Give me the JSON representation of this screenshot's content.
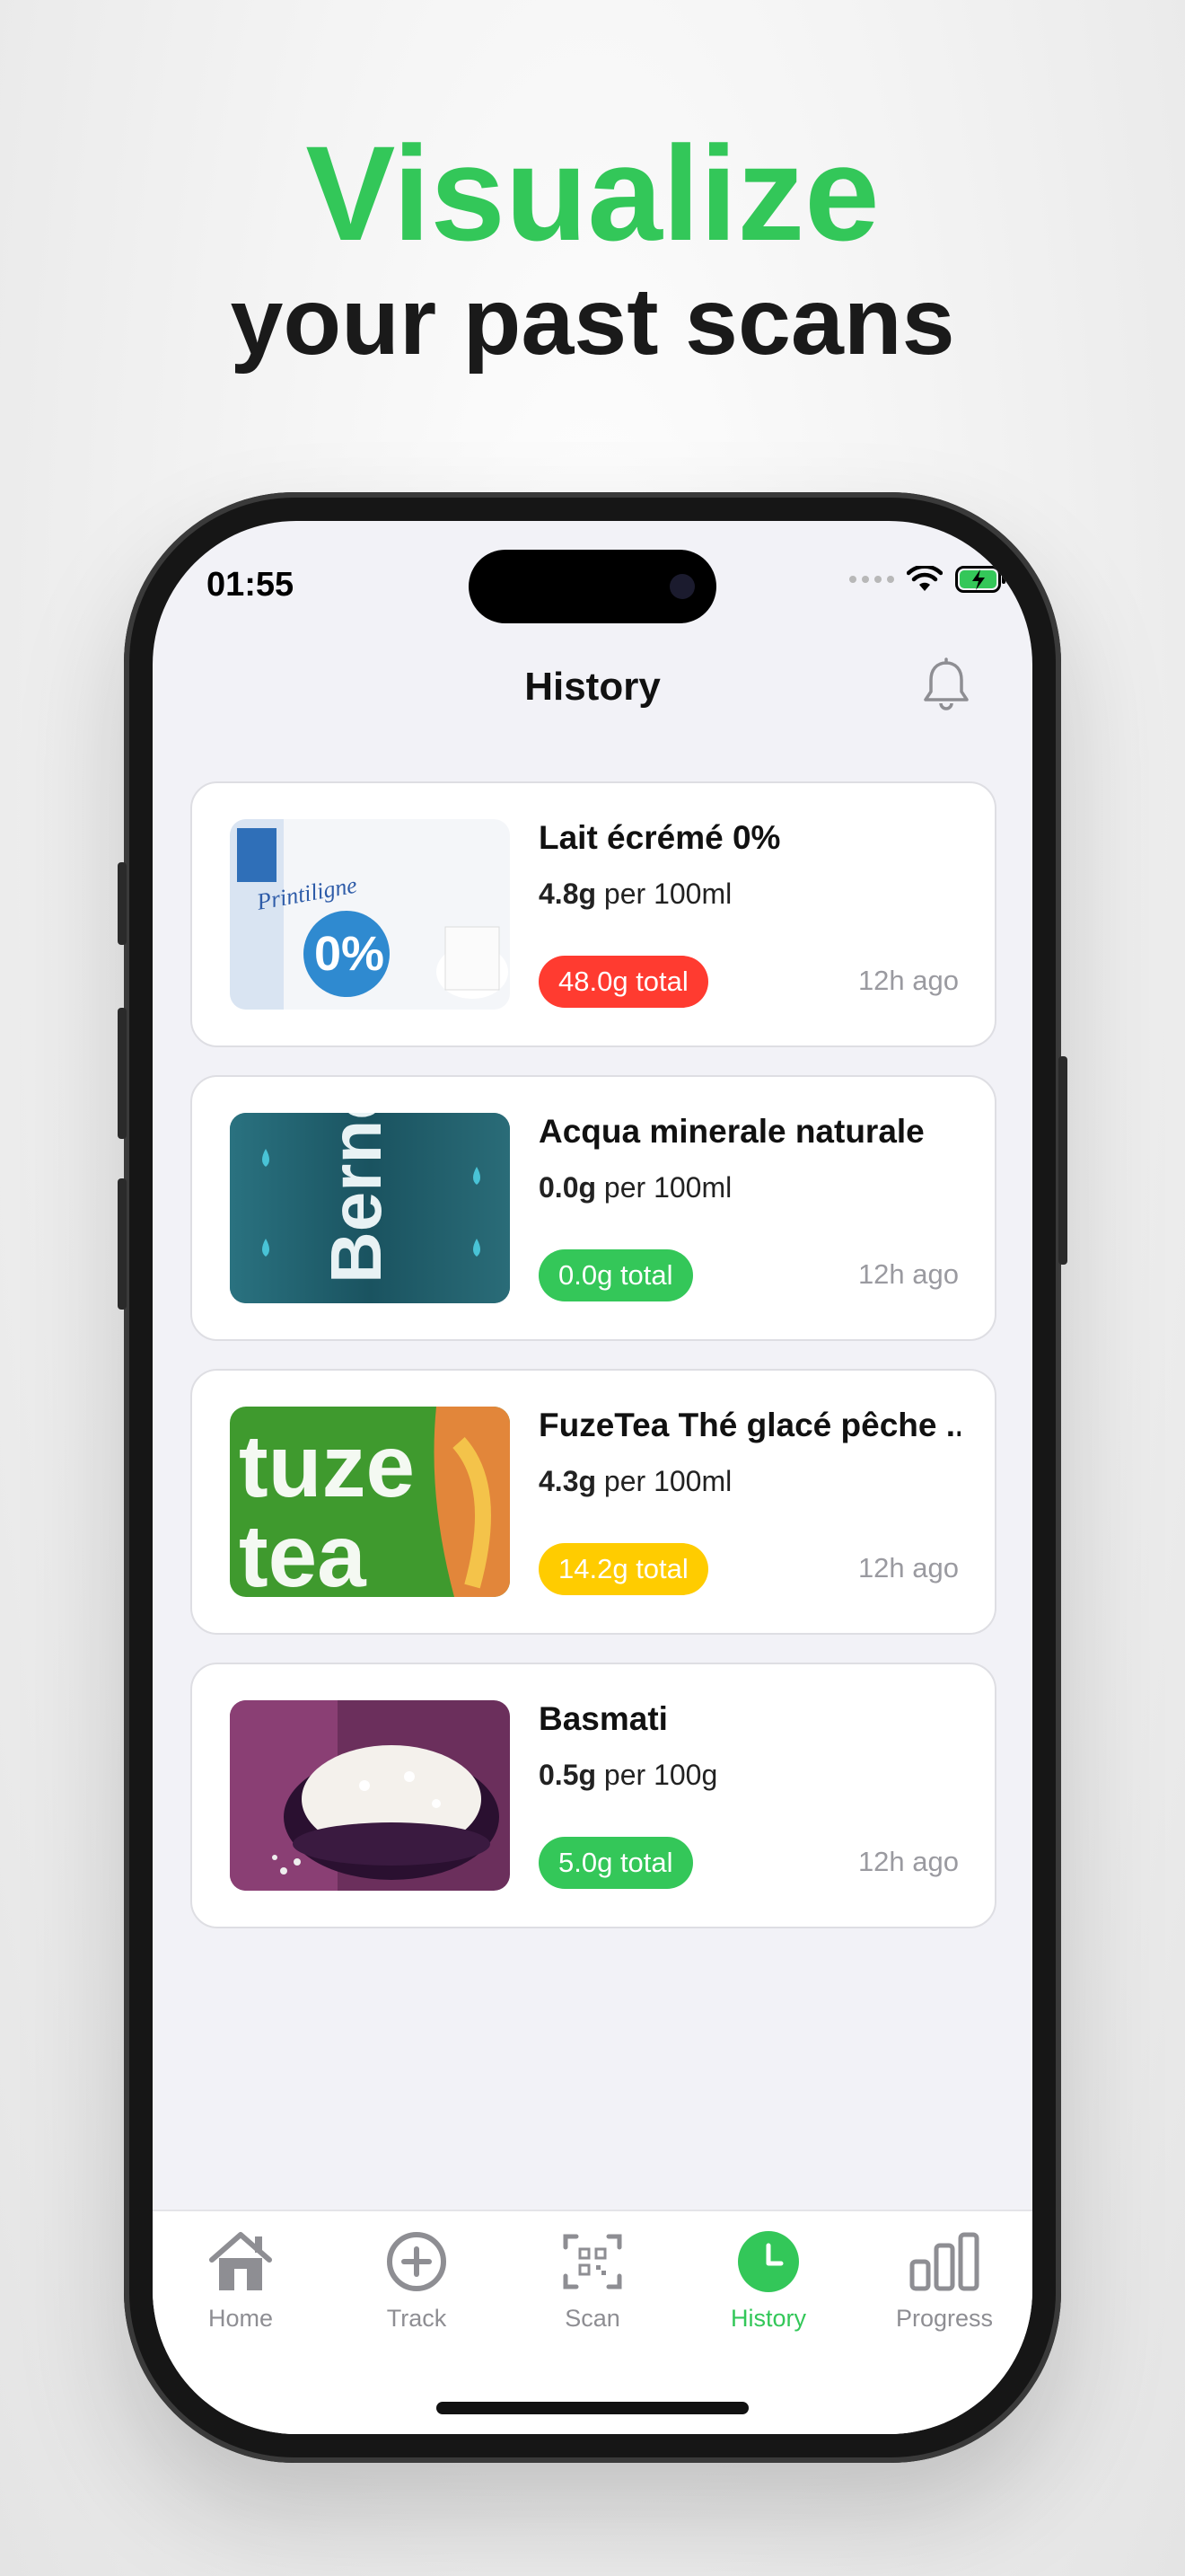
{
  "headline": {
    "line1": "Visualize",
    "line2": "your past scans"
  },
  "status_bar": {
    "time": "01:55"
  },
  "nav": {
    "title": "History"
  },
  "items": [
    {
      "name": "Lait écrémé 0%",
      "amount": "4.8g",
      "unit": "per 100ml",
      "total": "48.0g total",
      "time": "12h ago",
      "badge_color": "#ff3b30"
    },
    {
      "name": "Acqua minerale naturale",
      "amount": "0.0g",
      "unit": "per 100ml",
      "total": "0.0g total",
      "time": "12h ago",
      "badge_color": "#34c759"
    },
    {
      "name": "FuzeTea Thé glacé pêche ...",
      "amount": "4.3g",
      "unit": "per 100ml",
      "total": "14.2g total",
      "time": "12h ago",
      "badge_color": "#ffcc00"
    },
    {
      "name": "Basmati",
      "amount": "0.5g",
      "unit": "per 100g",
      "total": "5.0g total",
      "time": "12h ago",
      "badge_color": "#34c759"
    }
  ],
  "tabs": [
    {
      "label": "Home",
      "icon": "home-icon"
    },
    {
      "label": "Track",
      "icon": "plus-circle-icon"
    },
    {
      "label": "Scan",
      "icon": "qr-scan-icon"
    },
    {
      "label": "History",
      "icon": "clock-icon",
      "active": true
    },
    {
      "label": "Progress",
      "icon": "bar-chart-icon"
    }
  ],
  "colors": {
    "accent": "#33c759",
    "headline_dark": "#1a1a1a",
    "screen_bg": "#f2f2f7"
  }
}
